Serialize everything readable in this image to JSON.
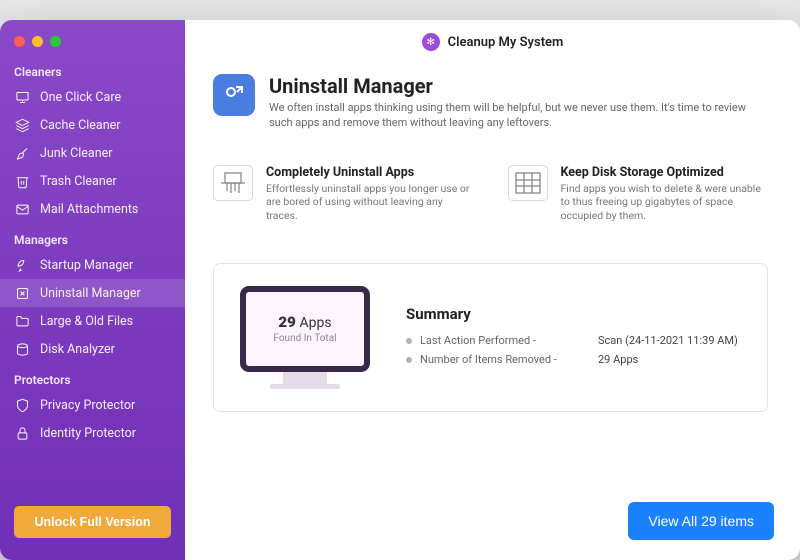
{
  "app_title": "Cleanup My System",
  "sidebar": {
    "sections": [
      {
        "label": "Cleaners",
        "items": [
          {
            "label": "One Click Care",
            "icon": "monitor-icon"
          },
          {
            "label": "Cache Cleaner",
            "icon": "layers-icon"
          },
          {
            "label": "Junk Cleaner",
            "icon": "broom-icon"
          },
          {
            "label": "Trash Cleaner",
            "icon": "trash-icon"
          },
          {
            "label": "Mail Attachments",
            "icon": "mail-icon"
          }
        ]
      },
      {
        "label": "Managers",
        "items": [
          {
            "label": "Startup Manager",
            "icon": "rocket-icon"
          },
          {
            "label": "Uninstall Manager",
            "icon": "uninstall-icon",
            "active": true
          },
          {
            "label": "Large & Old Files",
            "icon": "folder-icon"
          },
          {
            "label": "Disk Analyzer",
            "icon": "disk-icon"
          }
        ]
      },
      {
        "label": "Protectors",
        "items": [
          {
            "label": "Privacy Protector",
            "icon": "shield-icon"
          },
          {
            "label": "Identity Protector",
            "icon": "lock-icon"
          }
        ]
      }
    ],
    "unlock_label": "Unlock Full Version"
  },
  "page": {
    "title": "Uninstall Manager",
    "subtitle": "We often install apps thinking using them will be helpful, but we never use them. It's time to review such apps and remove them without leaving any leftovers."
  },
  "features": [
    {
      "title": "Completely Uninstall Apps",
      "desc": "Effortlessly uninstall apps you longer use or are bored of using without leaving any traces.",
      "icon": "shredder-icon"
    },
    {
      "title": "Keep Disk Storage Optimized",
      "desc": "Find apps you wish to delete & were unable to thus freeing up gigabytes of space occupied by them.",
      "icon": "grid-icon"
    }
  ],
  "summary": {
    "title": "Summary",
    "monitor_count": "29",
    "monitor_unit": "Apps",
    "monitor_sub": "Found In Total",
    "rows": [
      {
        "label": "Last Action Performed -",
        "value": "Scan (24-11-2021 11:39 AM)"
      },
      {
        "label": "Number of Items Removed -",
        "value": "29 Apps"
      }
    ]
  },
  "view_button": "View All 29 items"
}
